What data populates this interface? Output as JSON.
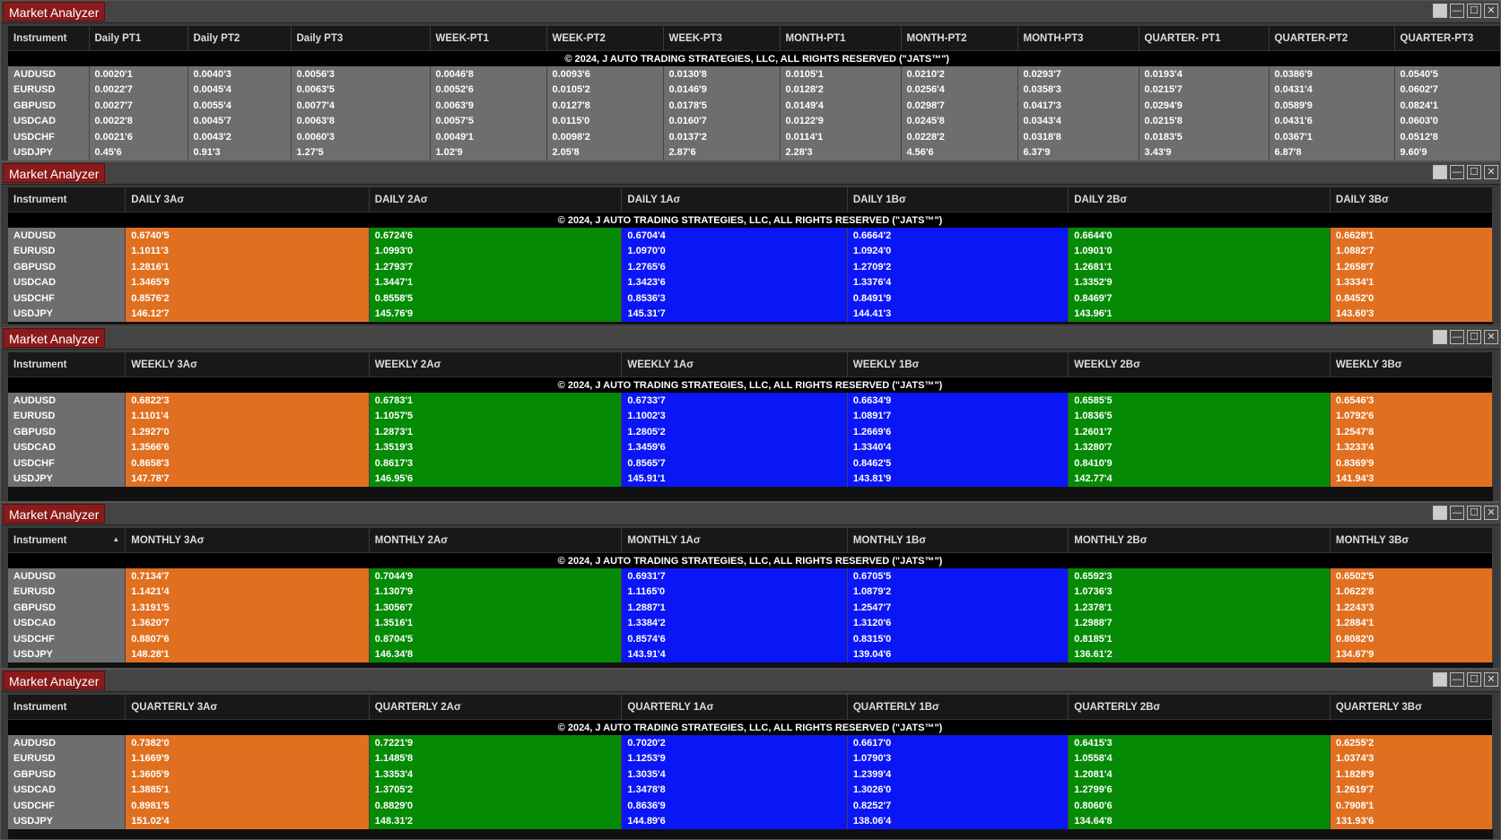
{
  "windows": [
    {
      "title": "Market Analyzer",
      "headers": [
        "Instrument",
        "Daily PT1",
        "Daily PT2",
        "Daily PT3",
        "WEEK-PT1",
        "WEEK-PT2",
        "WEEK-PT3",
        "MONTH-PT1",
        "MONTH-PT2",
        "MONTH-PT3",
        "QUARTER- PT1",
        "QUARTER-PT2",
        "QUARTER-PT3"
      ],
      "copyright": "© 2024, J AUTO TRADING STRATEGIES, LLC, ALL RIGHTS RESERVED (\"JATS™\")",
      "rows": [
        [
          "AUDUSD",
          "0.0020'1",
          "0.0040'3",
          "0.0056'3",
          "0.0046'8",
          "0.0093'6",
          "0.0130'8",
          "0.0105'1",
          "0.0210'2",
          "0.0293'7",
          "0.0193'4",
          "0.0386'9",
          "0.0540'5"
        ],
        [
          "EURUSD",
          "0.0022'7",
          "0.0045'4",
          "0.0063'5",
          "0.0052'6",
          "0.0105'2",
          "0.0146'9",
          "0.0128'2",
          "0.0256'4",
          "0.0358'3",
          "0.0215'7",
          "0.0431'4",
          "0.0602'7"
        ],
        [
          "GBPUSD",
          "0.0027'7",
          "0.0055'4",
          "0.0077'4",
          "0.0063'9",
          "0.0127'8",
          "0.0178'5",
          "0.0149'4",
          "0.0298'7",
          "0.0417'3",
          "0.0294'9",
          "0.0589'9",
          "0.0824'1"
        ],
        [
          "USDCAD",
          "0.0022'8",
          "0.0045'7",
          "0.0063'8",
          "0.0057'5",
          "0.0115'0",
          "0.0160'7",
          "0.0122'9",
          "0.0245'8",
          "0.0343'4",
          "0.0215'8",
          "0.0431'6",
          "0.0603'0"
        ],
        [
          "USDCHF",
          "0.0021'6",
          "0.0043'2",
          "0.0060'3",
          "0.0049'1",
          "0.0098'2",
          "0.0137'2",
          "0.0114'1",
          "0.0228'2",
          "0.0318'8",
          "0.0183'5",
          "0.0367'1",
          "0.0512'8"
        ],
        [
          "USDJPY",
          "0.45'6",
          "0.91'3",
          "1.27'5",
          "1.02'9",
          "2.05'8",
          "2.87'6",
          "2.28'3",
          "4.56'6",
          "6.37'9",
          "3.43'9",
          "6.87'8",
          "9.60'9"
        ]
      ],
      "col_colors": [
        "gray",
        "gray",
        "gray",
        "gray",
        "gray",
        "gray",
        "gray",
        "gray",
        "gray",
        "gray",
        "gray",
        "gray"
      ]
    },
    {
      "title": "Market Analyzer",
      "headers": [
        "Instrument",
        "DAILY 3Aσ",
        "DAILY 2Aσ",
        "DAILY 1Aσ",
        "DAILY 1Bσ",
        "DAILY 2Bσ",
        "DAILY 3Bσ"
      ],
      "copyright": "© 2024, J AUTO TRADING STRATEGIES, LLC, ALL RIGHTS RESERVED (\"JATS™\")",
      "rows": [
        [
          "AUDUSD",
          "0.6740'5",
          "0.6724'6",
          "0.6704'4",
          "0.6664'2",
          "0.6644'0",
          "0.6628'1"
        ],
        [
          "EURUSD",
          "1.1011'3",
          "1.0993'0",
          "1.0970'0",
          "1.0924'0",
          "1.0901'0",
          "1.0882'7"
        ],
        [
          "GBPUSD",
          "1.2816'1",
          "1.2793'7",
          "1.2765'6",
          "1.2709'2",
          "1.2681'1",
          "1.2658'7"
        ],
        [
          "USDCAD",
          "1.3465'9",
          "1.3447'1",
          "1.3423'6",
          "1.3376'4",
          "1.3352'9",
          "1.3334'1"
        ],
        [
          "USDCHF",
          "0.8576'2",
          "0.8558'5",
          "0.8536'3",
          "0.8491'9",
          "0.8469'7",
          "0.8452'0"
        ],
        [
          "USDJPY",
          "146.12'7",
          "145.76'9",
          "145.31'7",
          "144.41'3",
          "143.96'1",
          "143.60'3"
        ]
      ],
      "col_colors": [
        "orange",
        "green",
        "blue",
        "blue",
        "green",
        "orange"
      ]
    },
    {
      "title": "Market Analyzer",
      "headers": [
        "Instrument",
        "WEEKLY 3Aσ",
        "WEEKLY 2Aσ",
        "WEEKLY 1Aσ",
        "WEEKLY 1Bσ",
        "WEEKLY 2Bσ",
        "WEEKLY 3Bσ"
      ],
      "copyright": "© 2024, J AUTO TRADING STRATEGIES, LLC, ALL RIGHTS RESERVED (\"JATS™\")",
      "rows": [
        [
          "AUDUSD",
          "0.6822'3",
          "0.6783'1",
          "0.6733'7",
          "0.6634'9",
          "0.6585'5",
          "0.6546'3"
        ],
        [
          "EURUSD",
          "1.1101'4",
          "1.1057'5",
          "1.1002'3",
          "1.0891'7",
          "1.0836'5",
          "1.0792'6"
        ],
        [
          "GBPUSD",
          "1.2927'0",
          "1.2873'1",
          "1.2805'2",
          "1.2669'6",
          "1.2601'7",
          "1.2547'8"
        ],
        [
          "USDCAD",
          "1.3566'6",
          "1.3519'3",
          "1.3459'6",
          "1.3340'4",
          "1.3280'7",
          "1.3233'4"
        ],
        [
          "USDCHF",
          "0.8658'3",
          "0.8617'3",
          "0.8565'7",
          "0.8462'5",
          "0.8410'9",
          "0.8369'9"
        ],
        [
          "USDJPY",
          "147.78'7",
          "146.95'6",
          "145.91'1",
          "143.81'9",
          "142.77'4",
          "141.94'3"
        ]
      ],
      "col_colors": [
        "orange",
        "green",
        "blue",
        "blue",
        "green",
        "orange"
      ]
    },
    {
      "title": "Market Analyzer",
      "headers": [
        "Instrument",
        "MONTHLY 3Aσ",
        "MONTHLY 2Aσ",
        "MONTHLY 1Aσ",
        "MONTHLY 1Bσ",
        "MONTHLY 2Bσ",
        "MONTHLY 3Bσ"
      ],
      "copyright": "© 2024, J AUTO TRADING STRATEGIES, LLC, ALL RIGHTS RESERVED (\"JATS™\")",
      "rows": [
        [
          "AUDUSD",
          "0.7134'7",
          "0.7044'9",
          "0.6931'7",
          "0.6705'5",
          "0.6592'3",
          "0.6502'5"
        ],
        [
          "EURUSD",
          "1.1421'4",
          "1.1307'9",
          "1.1165'0",
          "1.0879'2",
          "1.0736'3",
          "1.0622'8"
        ],
        [
          "GBPUSD",
          "1.3191'5",
          "1.3056'7",
          "1.2887'1",
          "1.2547'7",
          "1.2378'1",
          "1.2243'3"
        ],
        [
          "USDCAD",
          "1.3620'7",
          "1.3516'1",
          "1.3384'2",
          "1.3120'6",
          "1.2988'7",
          "1.2884'1"
        ],
        [
          "USDCHF",
          "0.8807'6",
          "0.8704'5",
          "0.8574'6",
          "0.8315'0",
          "0.8185'1",
          "0.8082'0"
        ],
        [
          "USDJPY",
          "148.28'1",
          "146.34'8",
          "143.91'4",
          "139.04'6",
          "136.61'2",
          "134.67'9"
        ]
      ],
      "col_colors": [
        "orange",
        "green",
        "blue",
        "blue",
        "green",
        "orange"
      ]
    },
    {
      "title": "Market Analyzer",
      "headers": [
        "Instrument",
        "QUARTERLY 3Aσ",
        "QUARTERLY 2Aσ",
        "QUARTERLY 1Aσ",
        "QUARTERLY 1Bσ",
        "QUARTERLY 2Bσ",
        "QUARTERLY 3Bσ"
      ],
      "copyright": "© 2024, J AUTO TRADING STRATEGIES, LLC, ALL RIGHTS RESERVED (\"JATS™\")",
      "rows": [
        [
          "AUDUSD",
          "0.7382'0",
          "0.7221'9",
          "0.7020'2",
          "0.6617'0",
          "0.6415'3",
          "0.6255'2"
        ],
        [
          "EURUSD",
          "1.1669'9",
          "1.1485'8",
          "1.1253'9",
          "1.0790'3",
          "1.0558'4",
          "1.0374'3"
        ],
        [
          "GBPUSD",
          "1.3605'9",
          "1.3353'4",
          "1.3035'4",
          "1.2399'4",
          "1.2081'4",
          "1.1828'9"
        ],
        [
          "USDCAD",
          "1.3885'1",
          "1.3705'2",
          "1.3478'8",
          "1.3026'0",
          "1.2799'6",
          "1.2619'7"
        ],
        [
          "USDCHF",
          "0.8981'5",
          "0.8829'0",
          "0.8636'9",
          "0.8252'7",
          "0.8060'6",
          "0.7908'1"
        ],
        [
          "USDJPY",
          "151.02'4",
          "148.31'2",
          "144.89'6",
          "138.06'4",
          "134.64'8",
          "131.93'6"
        ]
      ],
      "col_colors": [
        "orange",
        "green",
        "blue",
        "blue",
        "green",
        "orange"
      ]
    }
  ],
  "window_buttons": [
    "",
    "—",
    "☐",
    "✕"
  ]
}
